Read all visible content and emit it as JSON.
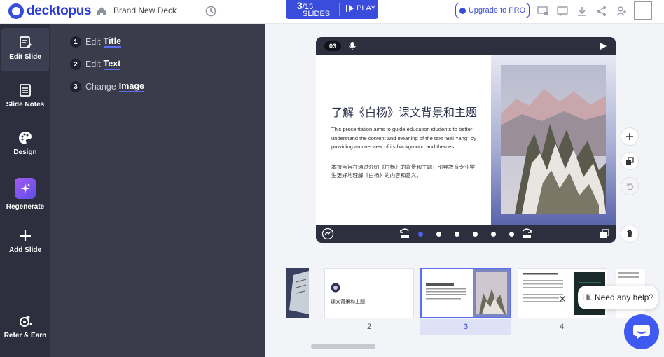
{
  "app": {
    "logo_text": "decktopus"
  },
  "header": {
    "deck_name": "Brand New Deck",
    "slides_current": "3",
    "slides_total": "15",
    "slides_label": "SLIDES",
    "play_label": "PLAY",
    "upgrade_label": "Upgrade to PRO"
  },
  "rail": {
    "items": [
      {
        "label": "Edit Slide",
        "icon": "edit-slide-icon"
      },
      {
        "label": "Slide Notes",
        "icon": "notes-icon"
      },
      {
        "label": "Design",
        "icon": "palette-icon"
      },
      {
        "label": "Regenerate",
        "icon": "sparkle-icon"
      },
      {
        "label": "Add Slide",
        "icon": "plus-icon"
      },
      {
        "label": "Refer & Earn",
        "icon": "gift-icon"
      }
    ]
  },
  "edit_panel": {
    "steps": [
      {
        "n": "1",
        "prefix": "Edit",
        "strong": "Title"
      },
      {
        "n": "2",
        "prefix": "Edit",
        "strong": "Text"
      },
      {
        "n": "3",
        "prefix": "Change",
        "strong": "Image"
      }
    ]
  },
  "slide": {
    "number": "03",
    "title": "了解《白杨》课文背景和主题",
    "paragraph": "This presentation aims to guide education students to better understand the content and meaning of the text \"Bai Yang\" by providing an overview of its background and themes.",
    "paragraph_cn": "本报告旨在通过介绍《白杨》的背景和主题，引导教育专业学生更好地理解《白杨》的内容和意义。"
  },
  "filmstrip": {
    "thumb_2_text": "课文背景和主题",
    "numbers": [
      "2",
      "3",
      "4"
    ]
  },
  "help": {
    "text": "Hi. Need any help?",
    "close": "✕"
  },
  "colors": {
    "accent": "#3a4cdb",
    "rail_bg": "#2d2f3e",
    "panel_bg": "#3a3c4c"
  }
}
